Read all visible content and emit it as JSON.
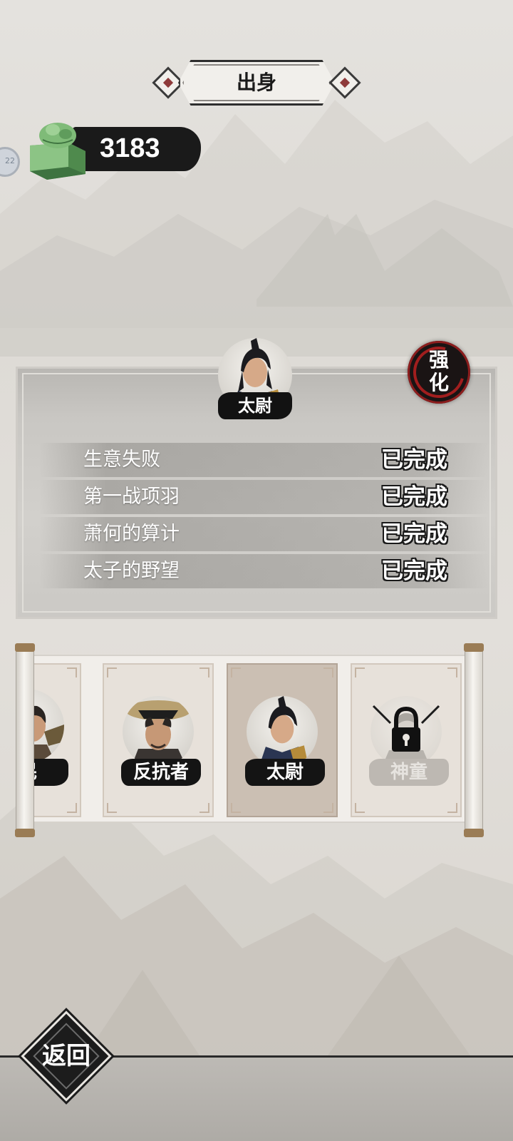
{
  "header": {
    "title": "出身"
  },
  "currency": {
    "amount": "3183",
    "icon": "jade-seal-icon",
    "avatar_badge": "22"
  },
  "hero": {
    "name": "太尉"
  },
  "enhance": {
    "line1": "强",
    "line2": "化"
  },
  "tasks": [
    {
      "name": "生意失败",
      "status": "已完成"
    },
    {
      "name": "第一战项羽",
      "status": "已完成"
    },
    {
      "name": "萧何的算计",
      "status": "已完成"
    },
    {
      "name": "太子的野望",
      "status": "已完成"
    }
  ],
  "origins": [
    {
      "name": "民",
      "state": "partial"
    },
    {
      "name": "反抗者",
      "state": "unlocked"
    },
    {
      "name": "太尉",
      "state": "selected"
    },
    {
      "name": "神童",
      "state": "locked",
      "icon": "lock-icon"
    }
  ],
  "footer": {
    "back_label": "返回"
  },
  "colors": {
    "ink": "#1a1a1a",
    "seal_red": "#a11e1e",
    "jade": "#6fae6b",
    "paper": "#f1eeea"
  }
}
